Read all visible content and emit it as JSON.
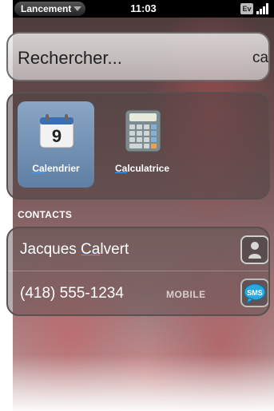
{
  "status_bar": {
    "launcher_label": "Lancement",
    "time": "11:03",
    "network_badge": "Ev"
  },
  "search": {
    "text": "Rechercher...",
    "suffix": "ca"
  },
  "apps": [
    {
      "label_before": "",
      "label_underline": "Ca",
      "label_after": "lendrier",
      "icon": "calendar-icon",
      "calendar_day": "9"
    },
    {
      "label_before": "",
      "label_underline": "Ca",
      "label_after": "lculatrice",
      "icon": "calculator-icon"
    }
  ],
  "contacts": {
    "header": "CONTACTS",
    "name_before": "Jacques ",
    "name_underline": "Ca",
    "name_after": "lvert",
    "phone": "(418) 555-1234",
    "phone_type": "MOBILE",
    "sms_label": "SMS"
  },
  "colors": {
    "accent_underline": "#3da0ff",
    "sms_bubble": "#29a9df"
  }
}
